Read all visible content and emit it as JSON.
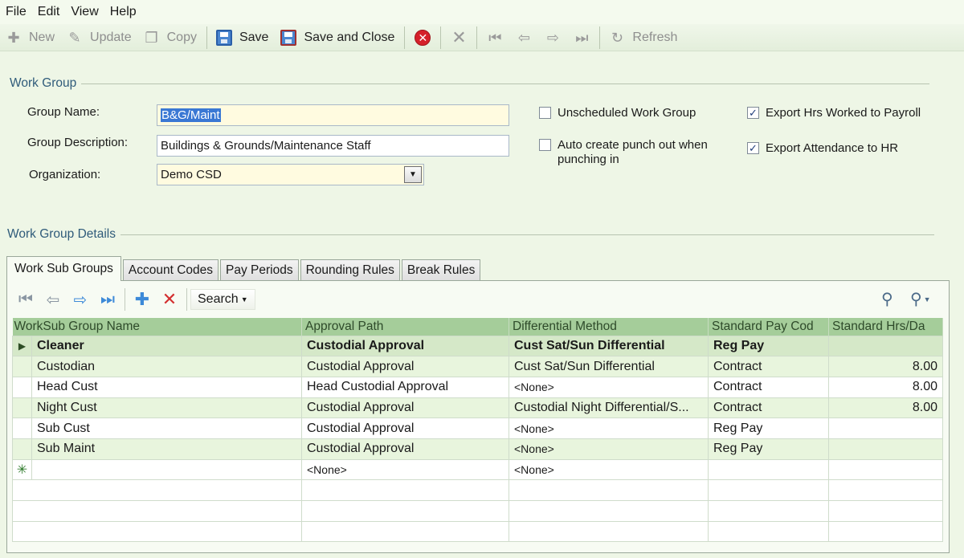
{
  "menu": [
    "File",
    "Edit",
    "View",
    "Help"
  ],
  "toolbar": {
    "new": "New",
    "update": "Update",
    "copy": "Copy",
    "save": "Save",
    "save_close": "Save and Close",
    "refresh": "Refresh"
  },
  "work_group": {
    "section_title": "Work Group",
    "group_name_label": "Group Name:",
    "group_name_value": "B&G/Maint",
    "group_description_label": "Group Description:",
    "group_description_value": "Buildings & Grounds/Maintenance Staff",
    "organization_label": "Organization:",
    "organization_value": "Demo CSD",
    "unscheduled_label": "Unscheduled Work Group",
    "unscheduled_checked": false,
    "auto_punch_label_line1": "Auto create punch out when",
    "auto_punch_label_line2": "punching in",
    "auto_punch_checked": false,
    "export_payroll_label": "Export Hrs Worked to Payroll",
    "export_payroll_checked": true,
    "export_hr_label": "Export Attendance to HR",
    "export_hr_checked": true
  },
  "details": {
    "section_title": "Work Group Details",
    "tabs": [
      "Work Sub Groups",
      "Account Codes",
      "Pay Periods",
      "Rounding Rules",
      "Break Rules"
    ],
    "active_tab": "Work Sub Groups",
    "search_label": "Search",
    "columns": [
      "WorkSub Group Name",
      "Approval Path",
      "Differential Method",
      "Standard Pay Cod",
      "Standard Hrs/Da"
    ],
    "rows": [
      {
        "name": "Cleaner",
        "approval": "Custodial Approval",
        "differential": "Cust Sat/Sun Differential",
        "pay_code": "Reg Pay",
        "hours": ""
      },
      {
        "name": "Custodian",
        "approval": "Custodial Approval",
        "differential": "Cust Sat/Sun Differential",
        "pay_code": "Contract",
        "hours": "8.00"
      },
      {
        "name": "Head Cust",
        "approval": "Head Custodial Approval",
        "differential": "<None>",
        "pay_code": "Contract",
        "hours": "8.00"
      },
      {
        "name": "Night Cust",
        "approval": "Custodial Approval",
        "differential": "Custodial Night Differential/S...",
        "pay_code": "Contract",
        "hours": "8.00"
      },
      {
        "name": "Sub Cust",
        "approval": "Custodial Approval",
        "differential": "<None>",
        "pay_code": "Reg Pay",
        "hours": ""
      },
      {
        "name": "Sub Maint",
        "approval": "Custodial Approval",
        "differential": "<None>",
        "pay_code": "Reg Pay",
        "hours": ""
      }
    ],
    "new_row": {
      "approval": "<None>",
      "differential": "<None>"
    }
  }
}
